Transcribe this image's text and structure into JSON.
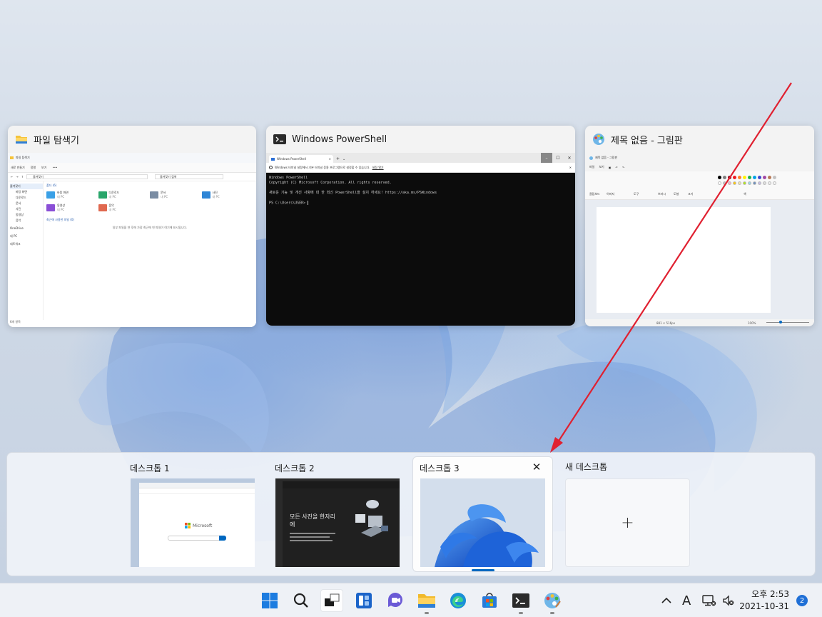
{
  "windows": {
    "explorer": {
      "title": "파일 탐색기",
      "inner_title": "파일 탐색기",
      "cmd_items": [
        "새로 만들기",
        "정렬",
        "보기"
      ],
      "address": "즐겨찾기",
      "search_placeholder": "즐겨찾기 검색",
      "nav": [
        "즐겨찾기",
        "바탕 화면",
        "다운로드",
        "문서",
        "사진",
        "동영상",
        "음악",
        "OneDrive",
        "내 PC",
        "네트워크"
      ],
      "section_folders": "폴더 (6)",
      "folders": [
        {
          "name": "바탕 화면",
          "sub": "내 PC",
          "color": "#3aa0e6"
        },
        {
          "name": "다운로드",
          "sub": "내 PC",
          "color": "#2aa66b"
        },
        {
          "name": "문서",
          "sub": "내 PC",
          "color": "#7a8ca3"
        },
        {
          "name": "사진",
          "sub": "내 PC",
          "color": "#2f86d6"
        },
        {
          "name": "동영상",
          "sub": "내 PC",
          "color": "#8a4fd6"
        },
        {
          "name": "음악",
          "sub": "내 PC",
          "color": "#e0684f"
        }
      ],
      "section_recent": "최근에 사용한 파일 (0)",
      "recent_empty": "일부 파일을 연 후에 가장 최근에 연 파일이 여기에 표시됩니다.",
      "status": "6개 항목"
    },
    "powershell": {
      "title": "Windows PowerShell",
      "tab_label": "Windows PowerShell",
      "notice": "Windows 터미널 설정에서 기본 터미널 응용 프로그램으로 설정할 수 있습니다.",
      "notice_link": "설정 열기",
      "lines": [
        "Windows PowerShell",
        "Copyright (C) Microsoft Corporation. All rights reserved.",
        "",
        "새로운 기능 및 개선 사항에 대 한 최신 PowerShell을 설치 하세요! https://aka.ms/PSWindows",
        "",
        "PS C:\\Users\\USER> "
      ]
    },
    "paint": {
      "title": "제목 없음 - 그림판",
      "inner_title": "제목 없음 - 그림판",
      "menu": [
        "파일",
        "보기"
      ],
      "groups": [
        "클립보드",
        "이미지",
        "도구",
        "브러시",
        "도형",
        "크기",
        "색"
      ],
      "status_size": "881 × 516px",
      "zoom": "100%"
    }
  },
  "desktops": {
    "items": [
      {
        "label": "데스크톱 1"
      },
      {
        "label": "데스크톱 2"
      },
      {
        "label": "데스크톱 3"
      }
    ],
    "new_label": "새 데스크톱",
    "new_plus": "+",
    "close_glyph": "✕",
    "thumb1": {
      "brand": "Microsoft"
    },
    "thumb2": {
      "heading": "모든 사진을 한자리에"
    }
  },
  "taskbar": {
    "tray_up": "^",
    "ime": "A",
    "time": "오후 2:53",
    "date": "2021-10-31",
    "notification_count": "2"
  },
  "colors": {
    "accent": "#0067c0",
    "annotation_arrow": "#e02030"
  }
}
